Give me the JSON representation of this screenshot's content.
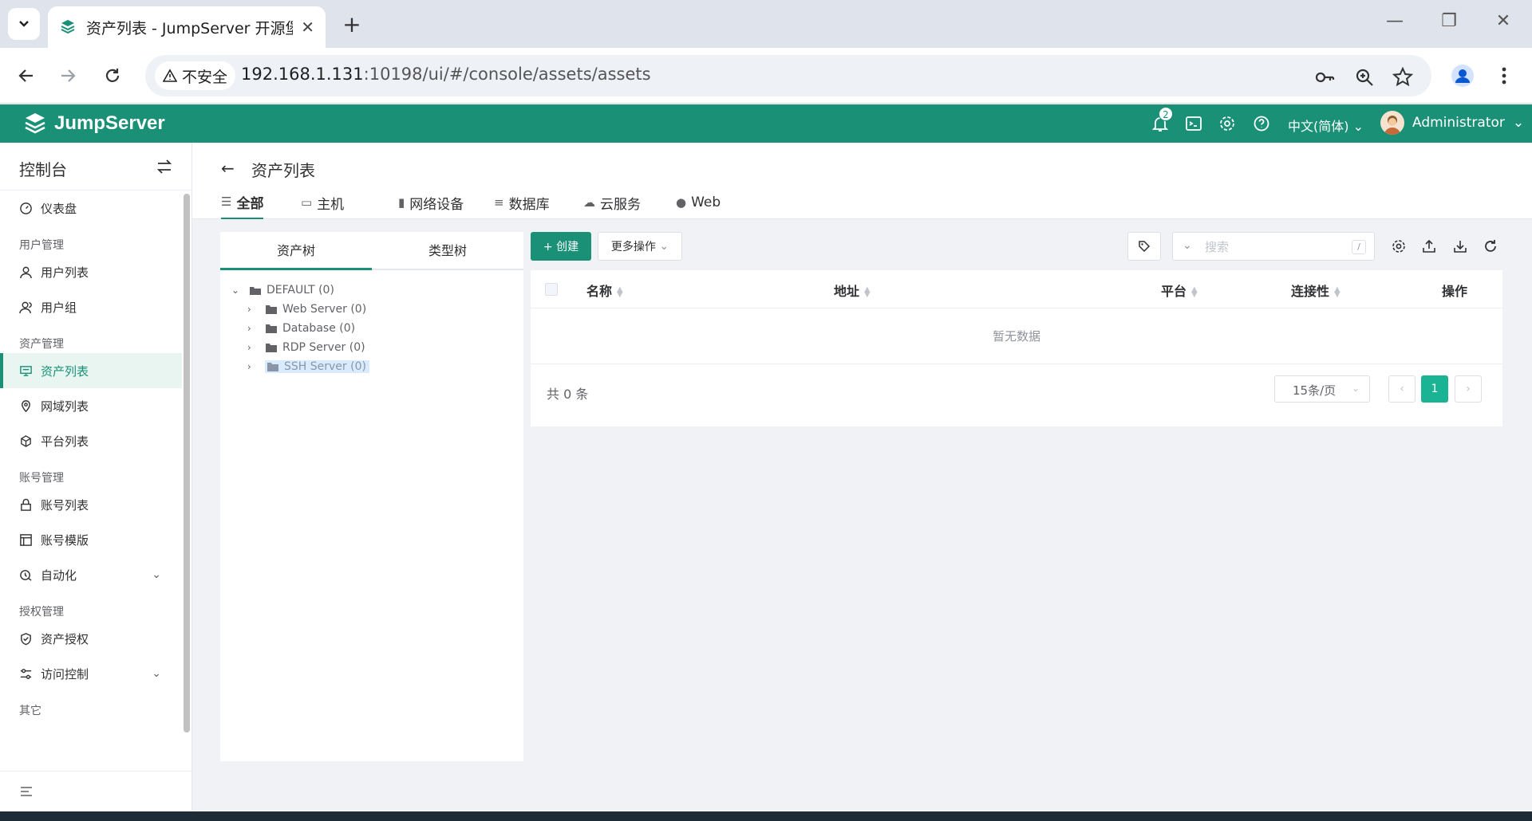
{
  "browser": {
    "tab_title": "资产列表 - JumpServer 开源堡",
    "security_label": "不安全",
    "url_host": "192.168.1.131",
    "url_rest": ":10198/ui/#/console/assets/assets"
  },
  "header": {
    "logo_text": "JumpServer",
    "notification_count": "2",
    "language": "中文(简体)",
    "user_name": "Administrator"
  },
  "sidebar": {
    "title": "控制台",
    "items": [
      {
        "type": "item",
        "label": "仪表盘",
        "icon": "dashboard-icon"
      },
      {
        "type": "group",
        "label": "用户管理"
      },
      {
        "type": "item",
        "label": "用户列表",
        "icon": "user-icon"
      },
      {
        "type": "item",
        "label": "用户组",
        "icon": "user-group-icon"
      },
      {
        "type": "group",
        "label": "资产管理"
      },
      {
        "type": "item",
        "label": "资产列表",
        "icon": "monitor-icon",
        "active": true
      },
      {
        "type": "item",
        "label": "网域列表",
        "icon": "location-icon"
      },
      {
        "type": "item",
        "label": "平台列表",
        "icon": "cube-icon"
      },
      {
        "type": "group",
        "label": "账号管理"
      },
      {
        "type": "item",
        "label": "账号列表",
        "icon": "lock-icon"
      },
      {
        "type": "item",
        "label": "账号模版",
        "icon": "template-icon"
      },
      {
        "type": "item",
        "label": "自动化",
        "icon": "automation-icon",
        "expandable": true
      },
      {
        "type": "group",
        "label": "授权管理"
      },
      {
        "type": "item",
        "label": "资产授权",
        "icon": "shield-icon"
      },
      {
        "type": "item",
        "label": "访问控制",
        "icon": "access-control-icon",
        "expandable": true
      },
      {
        "type": "group",
        "label": "其它"
      }
    ]
  },
  "page": {
    "title": "资产列表",
    "tabs": [
      {
        "label": "全部",
        "icon": "list-icon",
        "active": true
      },
      {
        "label": "主机",
        "icon": "host-icon"
      },
      {
        "label": "网络设备",
        "icon": "network-device-icon"
      },
      {
        "label": "数据库",
        "icon": "database-icon"
      },
      {
        "label": "云服务",
        "icon": "cloud-icon"
      },
      {
        "label": "Web",
        "icon": "globe-icon"
      }
    ]
  },
  "tree": {
    "tabs": [
      "资产树",
      "类型树"
    ],
    "root": "DEFAULT (0)",
    "children": [
      "Web Server (0)",
      "Database (0)",
      "RDP Server (0)",
      "SSH Server (0)"
    ],
    "selected_index": 3
  },
  "table": {
    "create_label": "+ 创建",
    "more_label": "更多操作",
    "search_placeholder": "搜索",
    "search_shortcut": "/",
    "columns": [
      {
        "label": "名称",
        "sortable": true
      },
      {
        "label": "地址",
        "sortable": true
      },
      {
        "label": "平台",
        "sortable": true
      },
      {
        "label": "连接性",
        "sortable": true
      },
      {
        "label": "操作",
        "sortable": false
      }
    ],
    "empty_text": "暂无数据",
    "total_text": "共 0 条",
    "page_size": "15条/页",
    "current_page": "1"
  },
  "colors": {
    "brand": "#1a9177",
    "active_page": "#1ab394"
  }
}
